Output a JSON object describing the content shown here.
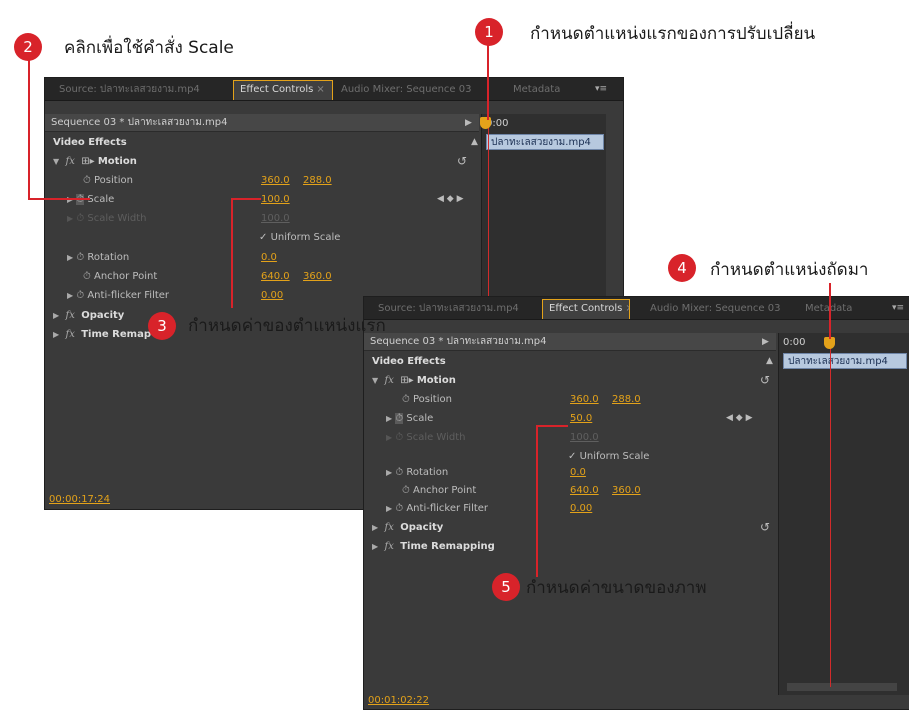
{
  "callouts": {
    "c1": {
      "number": "1",
      "text": "กำหนดตำแหน่งแรกของการปรับเปลี่ยน"
    },
    "c2": {
      "number": "2",
      "text": "คลิกเพื่อใช้คำสั่ง Scale"
    },
    "c3": {
      "number": "3",
      "text": "กำหนดค่าของตำแหน่งแรก"
    },
    "c4": {
      "number": "4",
      "text": "กำหนดตำแหน่งถัดมา"
    },
    "c5": {
      "number": "5",
      "text": "กำหนดค่าขนาดของภาพ"
    }
  },
  "panel1": {
    "tabs": [
      "Source: ปลาทะเลสวยงาม.mp4",
      "Effect Controls",
      "Audio Mixer: Sequence 03",
      "Metadata"
    ],
    "sequence": "Sequence 03 * ปลาทะเลสวยงาม.mp4",
    "timecode_head": "0:00",
    "clip": "ปลาทะเลสวยงาม.mp4",
    "video_effects": "Video Effects",
    "motion": "Motion",
    "position_label": "Position",
    "position_x": "360.0",
    "position_y": "288.0",
    "scale_label": "Scale",
    "scale_value": "100.0",
    "scale_width_label": "Scale Width",
    "scale_width_value": "100.0",
    "uniform_scale": "Uniform Scale",
    "rotation_label": "Rotation",
    "rotation_value": "0.0",
    "anchor_label": "Anchor Point",
    "anchor_x": "640.0",
    "anchor_y": "360.0",
    "antiflicker_label": "Anti-flicker Filter",
    "antiflicker_value": "0.00",
    "opacity": "Opacity",
    "time_remap": "Time Remap",
    "timecode": "00:00:17:24"
  },
  "panel2": {
    "tabs": [
      "Source: ปลาทะเลสวยงาม.mp4",
      "Effect Controls",
      "Audio Mixer: Sequence 03",
      "Metadata"
    ],
    "sequence": "Sequence 03 * ปลาทะเลสวยงาม.mp4",
    "timecode_head": "0:00",
    "clip": "ปลาทะเลสวยงาม.mp4",
    "video_effects": "Video Effects",
    "motion": "Motion",
    "position_label": "Position",
    "position_x": "360.0",
    "position_y": "288.0",
    "scale_label": "Scale",
    "scale_value": "50.0",
    "scale_width_label": "Scale Width",
    "scale_width_value": "100.0",
    "uniform_scale": "Uniform Scale",
    "rotation_label": "Rotation",
    "rotation_value": "0.0",
    "anchor_label": "Anchor Point",
    "anchor_x": "640.0",
    "anchor_y": "360.0",
    "antiflicker_label": "Anti-flicker Filter",
    "antiflicker_value": "0.00",
    "opacity": "Opacity",
    "time_remapping": "Time Remapping",
    "timecode": "00:01:02:22"
  },
  "colors": {
    "accent": "#e3a21a",
    "callout": "#d8232a",
    "playhead": "#d22b2b",
    "clip": "#b7c9df"
  }
}
